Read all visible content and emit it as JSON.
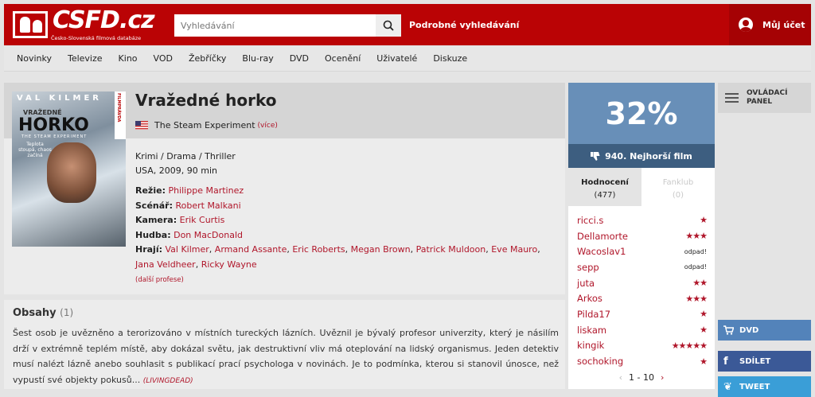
{
  "header": {
    "logo_text": "CSFD.cz",
    "logo_subtitle": "Česko-Slovenská filmová databáze",
    "search_placeholder": "Vyhledávání",
    "advanced_search": "Podrobné vyhledávání",
    "account": "Můj účet",
    "colors": {
      "brand_red": "#ba0305"
    }
  },
  "nav": [
    "Novinky",
    "Televize",
    "Kino",
    "VOD",
    "Žebříčky",
    "Blu-ray",
    "DVD",
    "Ocenění",
    "Uživatelé",
    "Diskuze"
  ],
  "film": {
    "poster": {
      "actor": "VAL KILMER",
      "title_small": "VRAŽEDNÉ",
      "title_big": "HORKO",
      "subtitle": "THE STEAM EXPERIMENT",
      "tagline": "Teplota stoupá, chaos začíná",
      "badge": "FILMPRÁVDA"
    },
    "title": "Vražedné horko",
    "alt_title": "The Steam Experiment",
    "alt_more": "(více)",
    "genre": "Krimi / Drama / Thriller",
    "origin": "USA, 2009, 90 min",
    "crew": {
      "directing_label": "Režie:",
      "directing": "Philippe Martinez",
      "writing_label": "Scénář:",
      "writing": "Robert Malkani",
      "camera_label": "Kamera:",
      "camera": "Erik Curtis",
      "music_label": "Hudba:",
      "music": "Don MacDonald",
      "cast_label": "Hrají:",
      "cast": [
        "Val Kilmer",
        "Armand Assante",
        "Eric Roberts",
        "Megan Brown",
        "Patrick Muldoon",
        "Eve Mauro",
        "Jana Veldheer",
        "Ricky Wayne"
      ],
      "other_professions": "(další profese)"
    }
  },
  "plot": {
    "heading": "Obsahy",
    "count": "(1)",
    "text": "Šest osob je uvězněno a terorizováno v místních tureckých lázních. Uvěznil je bývalý profesor univerzity, který je násilím drží v extrémně teplém místě, aby dokázal světu, jak destruktivní vliv má oteplování na lidský organismus. Jeden detektiv musí nalézt lázně anebo souhlasit s publikací prací psychologa v novinách. Je to podmínka, kterou si stanovil únosce, než vypustí své objekty pokusů...",
    "author": "(LIVINGDEAD)"
  },
  "rating": {
    "percent": "32%",
    "worst_rank": "940. Nejhorší film",
    "tab_ratings": "Hodnocení",
    "tab_ratings_count": "(477)",
    "tab_fanclub": "Fanklub",
    "tab_fanclub_count": "(0)",
    "list": [
      {
        "user": "ricci.s",
        "stars": "★"
      },
      {
        "user": "Dellamorte",
        "stars": "★★★"
      },
      {
        "user": "Wacoslav1",
        "stars": "odpad!"
      },
      {
        "user": "sepp",
        "stars": "odpad!"
      },
      {
        "user": "juta",
        "stars": "★★"
      },
      {
        "user": "Arkos",
        "stars": "★★★"
      },
      {
        "user": "Pilda17",
        "stars": "★"
      },
      {
        "user": "liskam",
        "stars": "★"
      },
      {
        "user": "kingik",
        "stars": "★★★★★"
      },
      {
        "user": "sochoking",
        "stars": "★"
      }
    ],
    "pager": "1 - 10",
    "colors": {
      "percent_bg": "#688fb8",
      "rank_bg": "#3d5e80"
    }
  },
  "sidebar": {
    "control_panel": "OVLÁDACÍ PANEL",
    "dvd": "DVD",
    "share": "SDÍLET",
    "tweet": "TWEET"
  }
}
